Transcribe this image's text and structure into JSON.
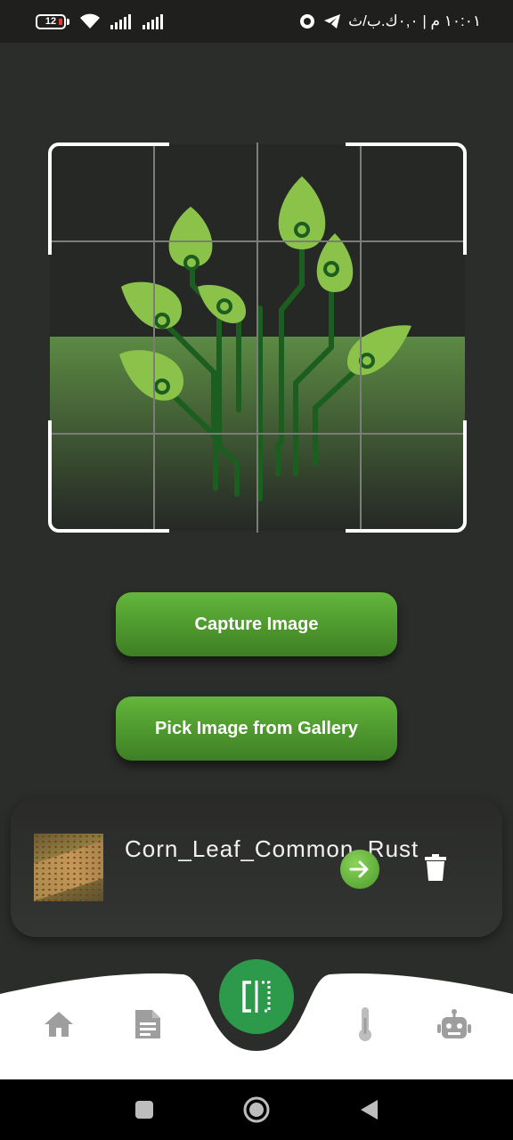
{
  "status_bar": {
    "battery_level": "12",
    "right_text": "١٠:٠١ م | ٠,٠ك.ب/ث"
  },
  "camera_frame": {
    "logo": "plant-circuit-logo"
  },
  "actions": {
    "capture_label": "Capture Image",
    "gallery_label": "Pick Image from Gallery"
  },
  "history": {
    "items": [
      {
        "name": "Corn_Leaf_Common_Rust",
        "thumbnail": "corn-leaf-thumbnail"
      }
    ]
  },
  "bottom_nav": {
    "items": [
      "home-icon",
      "document-icon",
      "scan-icon",
      "thermometer-icon",
      "robot-icon"
    ],
    "active": "scan-icon",
    "accent": "#2c9a4a"
  },
  "colors": {
    "background": "#2b2d2a",
    "button_green": "#4f9a2e",
    "leaf_green": "#8bc34a",
    "circuit_green": "#1b5e20"
  },
  "system_nav": [
    "recents-button",
    "home-button",
    "back-button"
  ]
}
